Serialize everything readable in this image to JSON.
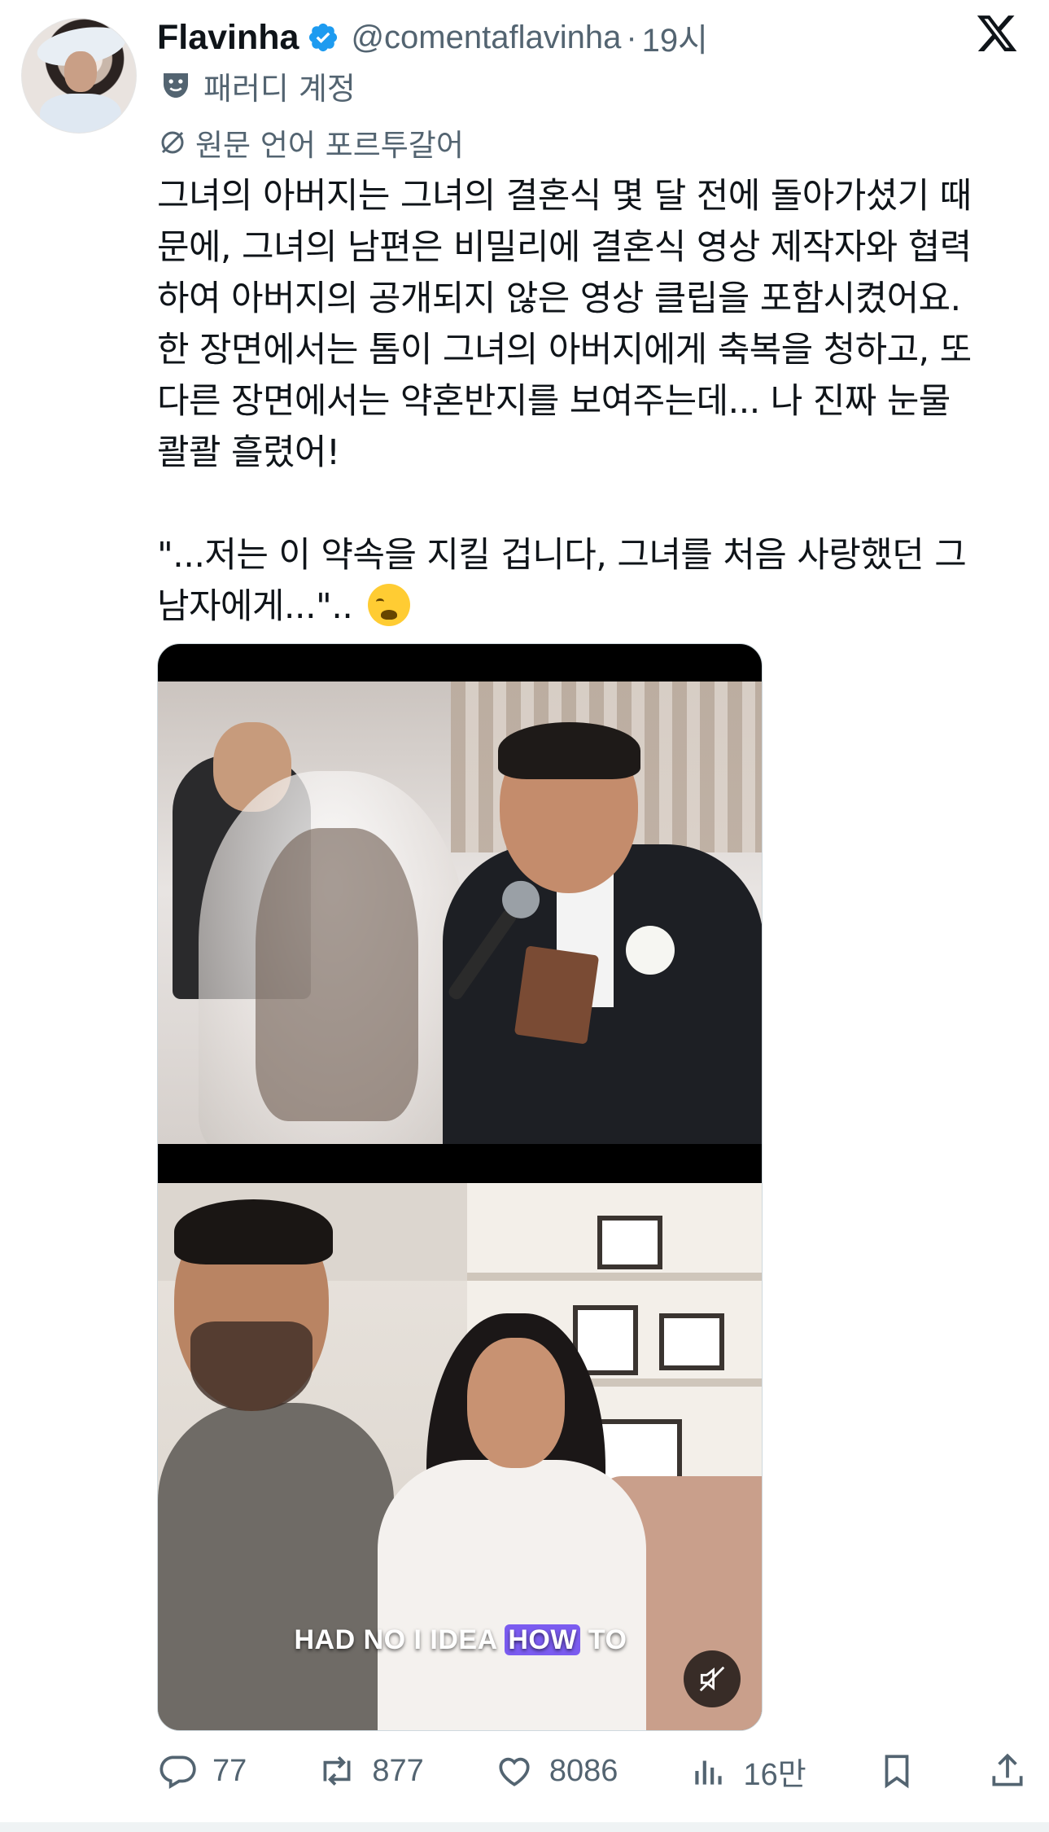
{
  "author": {
    "display_name": "Flavinha",
    "handle": "@comentaflavinha",
    "separator": "·",
    "time": "19시",
    "verified": true,
    "avatar_icon": "avatar-photo"
  },
  "labels": {
    "parody": "패러디 계정",
    "original_language": "원문 언어 포르투갈어"
  },
  "tweet": {
    "text": "그녀의 아버지는 그녀의 결혼식 몇 달 전에 돌아가셨기 때\n문에, 그녀의 남편은 비밀리에 결혼식 영상 제작자와 협력\n하여 아버지의 공개되지 않은 영상 클립을 포함시켰어요.\n한 장면에서는 톰이 그녀의 아버지에게 축복을 청하고, 또\n다른 장면에서는 약혼반지를 보여주는데... 나 진짜 눈물\n콸콸 흘렸어!\n\n\"...저는 이 약속을 지킬 겁니다, 그녀를 처음 사랑했던 그\n남자에게...\".. ",
    "emoji": "loudly-crying-face"
  },
  "media": {
    "caption_before": "HAD NO I IDEA ",
    "caption_highlight": "HOW",
    "caption_after": " TO",
    "muted": true
  },
  "actions": {
    "replies": "77",
    "reposts": "877",
    "likes": "8086",
    "views": "16만"
  },
  "colors": {
    "text": "#0f1419",
    "secondary": "#536471",
    "verified_blue": "#1d9bf0",
    "caption_highlight": "#7b5cf0"
  }
}
